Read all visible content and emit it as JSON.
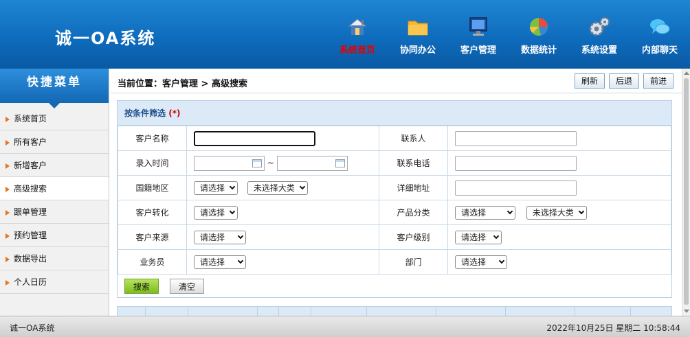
{
  "app": {
    "title": "诚一OA系统"
  },
  "nav": [
    {
      "label": "系统首页",
      "icon": "home-icon",
      "active": true
    },
    {
      "label": "协同办公",
      "icon": "folder-icon"
    },
    {
      "label": "客户管理",
      "icon": "monitor-icon"
    },
    {
      "label": "数据统计",
      "icon": "pie-chart-icon"
    },
    {
      "label": "系统设置",
      "icon": "gear-icon"
    },
    {
      "label": "内部聊天",
      "icon": "chat-icon"
    }
  ],
  "sidebar": {
    "title": "快捷菜单",
    "items": [
      "系统首页",
      "所有客户",
      "新增客户",
      "高级搜索",
      "跟单管理",
      "预约管理",
      "数据导出",
      "个人日历"
    ],
    "active_index": 3
  },
  "breadcrumb": "当前位置：客户管理 > 高级搜索",
  "toolbar": {
    "refresh": "刷新",
    "back": "后退",
    "forward": "前进"
  },
  "panel": {
    "title": "按条件筛选",
    "required_mark": "(*)",
    "rows": {
      "customer_name": "客户名称",
      "contact": "联系人",
      "entry_time": "录入时间",
      "tilde": "~",
      "phone": "联系电话",
      "region": "国籍地区",
      "address": "详细地址",
      "conversion": "客户转化",
      "product_category": "产品分类",
      "source": "客户来源",
      "level": "客户级别",
      "salesperson": "业务员",
      "department": "部门"
    },
    "select_default": "请选择",
    "select_major": "未选择大类",
    "search_label": "搜索",
    "clear_label": "清空"
  },
  "status": {
    "left": "诚一OA系统",
    "right": "2022年10月25日 星期二   10:58:44"
  }
}
